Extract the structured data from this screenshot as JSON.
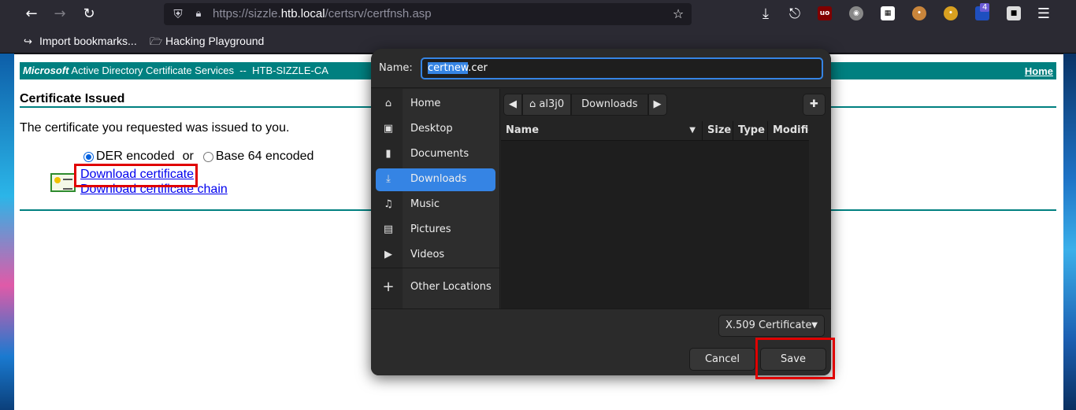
{
  "browser": {
    "url_prefix": "https://sizzle.",
    "url_host": "htb.local",
    "url_path": "/certsrv/certfnsh.asp",
    "extensions": {
      "container_badge": "4"
    },
    "bookmarks": [
      {
        "label": "Import bookmarks..."
      },
      {
        "label": "Hacking Playground"
      }
    ]
  },
  "page": {
    "header_brand": "Microsoft",
    "header_service": " Active Directory Certificate Services  --  HTB-SIZZLE-CA",
    "home_link": "Home",
    "heading": "Certificate Issued",
    "message": "The certificate you requested was issued to you.",
    "encoding": {
      "der_label": "DER encoded",
      "or_label": "or",
      "base64_label": "Base 64 encoded",
      "selected": "DER encoded"
    },
    "download_cert_link": "Download certificate",
    "download_chain_link": "Download certificate chain"
  },
  "dialog": {
    "name_label": "Name:",
    "filename_selected": "certnew",
    "filename_rest": ".cer",
    "places": [
      {
        "label": "Home",
        "icon": "home-icon"
      },
      {
        "label": "Desktop",
        "icon": "desktop-icon"
      },
      {
        "label": "Documents",
        "icon": "document-icon"
      },
      {
        "label": "Downloads",
        "icon": "download-icon",
        "active": true
      },
      {
        "label": "Music",
        "icon": "music-icon"
      },
      {
        "label": "Pictures",
        "icon": "pictures-icon"
      },
      {
        "label": "Videos",
        "icon": "video-icon"
      },
      {
        "label": "Other Locations",
        "icon": "plus-icon"
      }
    ],
    "path": [
      "al3j0",
      "Downloads"
    ],
    "columns": [
      "Name",
      "Size",
      "Type",
      "Modified"
    ],
    "filter": "X.509 Certificate",
    "cancel_label": "Cancel",
    "save_label": "Save"
  },
  "colors": {
    "header_teal": "#008080",
    "accent_blue": "#3584e4",
    "highlight_red": "#e00000"
  }
}
